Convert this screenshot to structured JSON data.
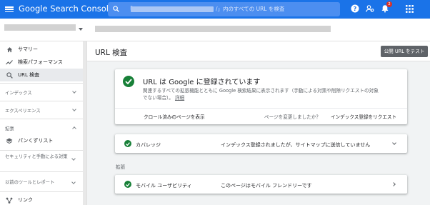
{
  "app": {
    "title_google": "Google",
    "title_product": "Search Console",
    "search_suffix": "/」内のすべての URL を検査",
    "search_prefix": "「",
    "notification_count": "2"
  },
  "sidebar": {
    "items": [
      {
        "label": "サマリー",
        "icon": "home-icon"
      },
      {
        "label": "検索パフォーマンス",
        "icon": "trend-icon"
      },
      {
        "label": "URL 検査",
        "icon": "search-icon"
      }
    ],
    "sections": [
      {
        "label": "インデックス"
      },
      {
        "label": "エクスペリエンス"
      },
      {
        "label": "拡張"
      }
    ],
    "breadcrumbs_label": "パンくずリスト",
    "security_label": "セキュリティと手動による対策",
    "legacy_label": "以前のツールとレポート",
    "links_label": "リンク"
  },
  "main": {
    "title": "URL 検査",
    "test_button": "公開 URL をテスト",
    "status_card": {
      "title": "URL は Google に登録されています",
      "desc": "関連するすべての拡張機能とともに Google 検索結果に表示されます（手動による対策や削除リクエストの対象でない場合）。",
      "details_link": "詳細",
      "view_crawled": "クロール済みのページを表示",
      "page_changed": "ページを変更しましたか？",
      "request_indexing": "インデックス登録をリクエスト"
    },
    "coverage": {
      "label": "カバレッジ",
      "status": "インデックス登録されましたが、サイトマップに送信していません"
    },
    "enhancements_label": "拡張",
    "mobile": {
      "label": "モバイル ユーザビリティ",
      "status": "このページはモバイル フレンドリーです"
    }
  },
  "colors": {
    "topbar": "#1a73e8",
    "success": "#188038",
    "button": "#5f6368"
  }
}
